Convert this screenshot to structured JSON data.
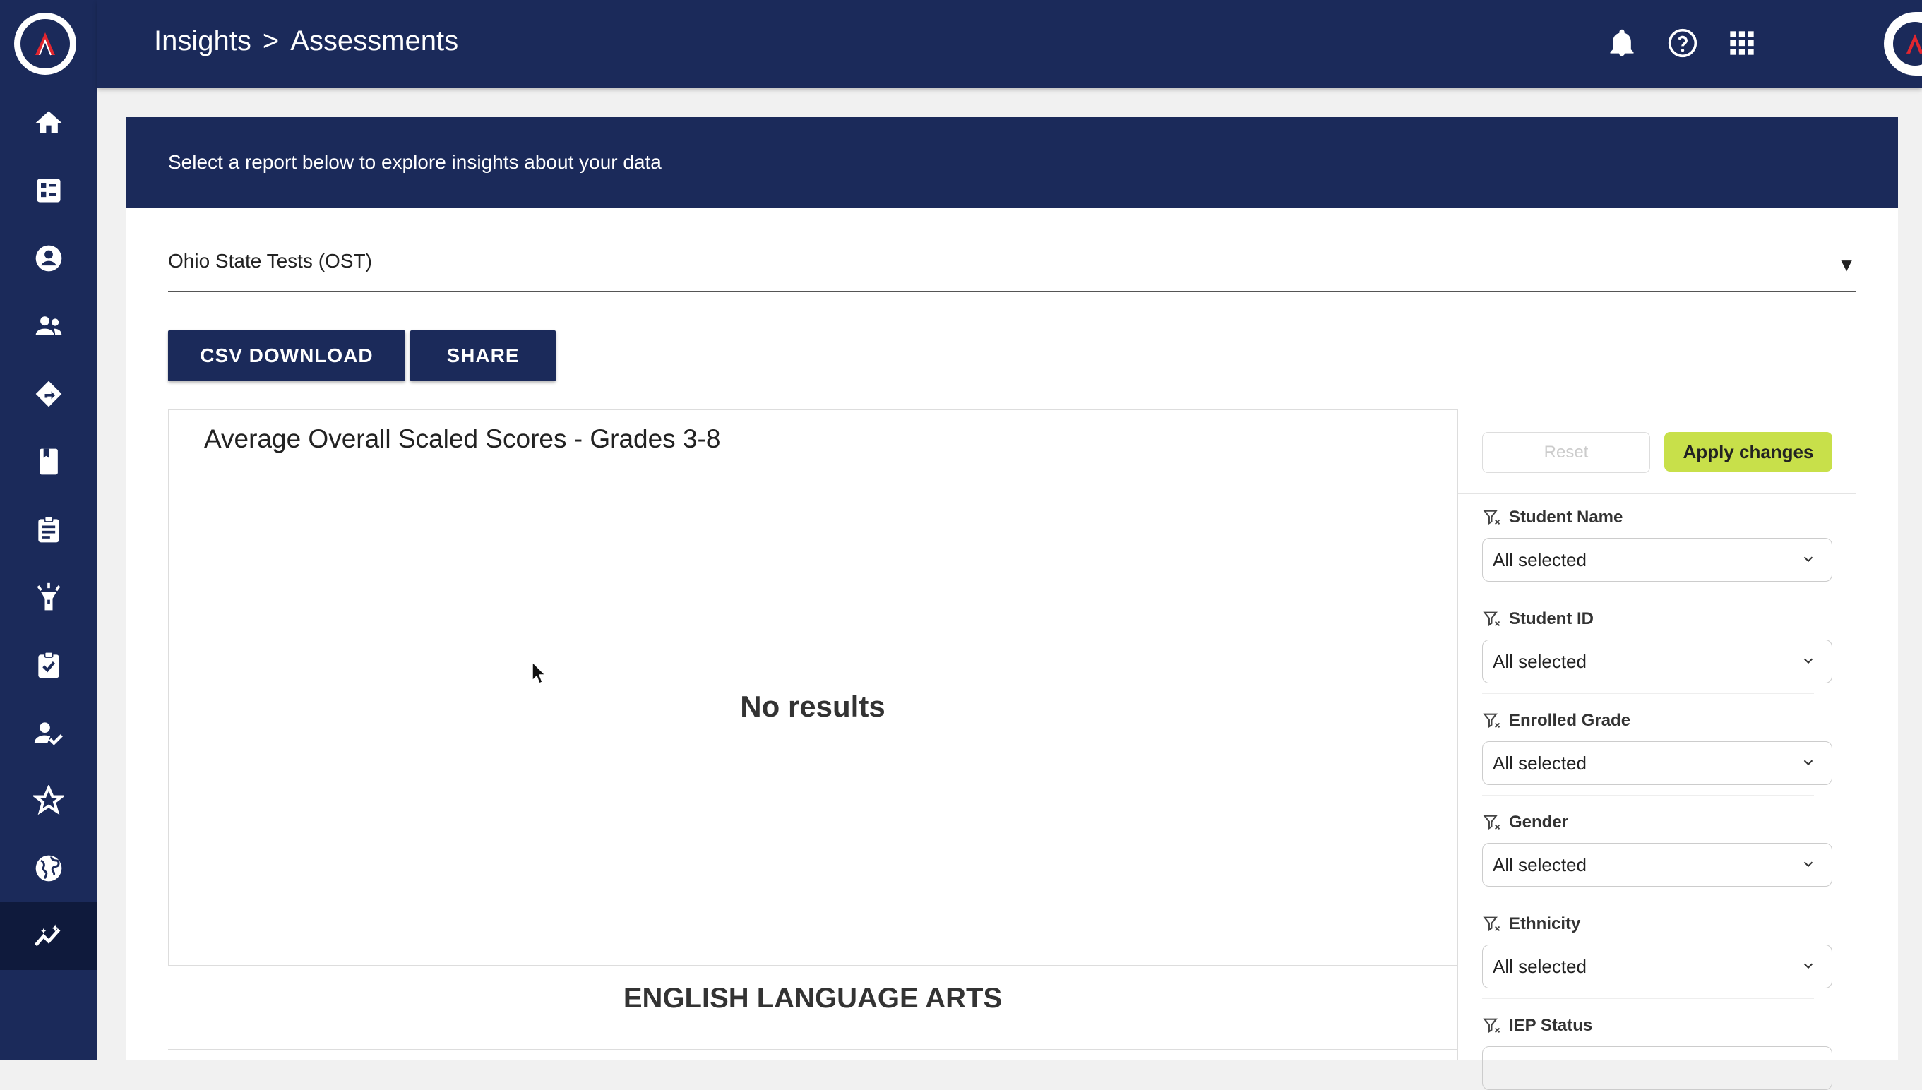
{
  "header": {
    "breadcrumb_root": "Insights",
    "breadcrumb_separator": ">",
    "breadcrumb_current": "Assessments"
  },
  "sidebar": {
    "items": [
      {
        "name": "home"
      },
      {
        "name": "dashboard"
      },
      {
        "name": "profile"
      },
      {
        "name": "groups"
      },
      {
        "name": "directions"
      },
      {
        "name": "book"
      },
      {
        "name": "assignments"
      },
      {
        "name": "spotlight"
      },
      {
        "name": "tasks"
      },
      {
        "name": "verified-user"
      },
      {
        "name": "favorites"
      },
      {
        "name": "globe"
      },
      {
        "name": "insights",
        "active": true
      }
    ]
  },
  "banner": {
    "text": "Select a report below to explore insights about your data"
  },
  "report_select": {
    "value": "Ohio State Tests (OST)",
    "arrow": "▼"
  },
  "actions": {
    "csv_download": "CSV DOWNLOAD",
    "share": "SHARE"
  },
  "chart": {
    "title": "Average Overall Scaled Scores - Grades 3-8",
    "empty_message": "No results"
  },
  "section_title": "ENGLISH LANGUAGE ARTS",
  "filters": {
    "reset_label": "Reset",
    "apply_label": "Apply changes",
    "items": [
      {
        "label": "Student Name",
        "value": "All selected"
      },
      {
        "label": "Student ID",
        "value": "All selected"
      },
      {
        "label": "Enrolled Grade",
        "value": "All selected"
      },
      {
        "label": "Gender",
        "value": "All selected"
      },
      {
        "label": "Ethnicity",
        "value": "All selected"
      },
      {
        "label": "IEP Status",
        "value": ""
      }
    ]
  },
  "colors": {
    "navy": "#1b2a5a",
    "apply_green": "#c8e04a"
  }
}
